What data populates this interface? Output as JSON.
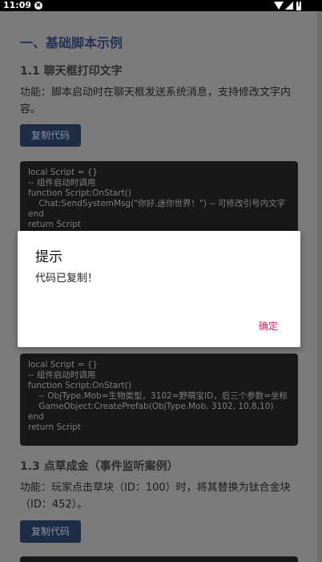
{
  "status_bar": {
    "time": "11:09",
    "notification_glyph": "✖"
  },
  "content": {
    "section_title": "一、基础脚本示例",
    "examples": [
      {
        "title": "1.1 聊天框打印文字",
        "desc": "功能：脚本启动时在聊天框发送系统消息，支持修改文字内容。",
        "copy_label": "复制代码",
        "code": "local Script = {}\n-- 组件启动时调用\nfunction Script:OnStart()\n    Chat:SendSystemMsg(\"你好,迷你世界！\") -- 可修改引号内文字\nend\nreturn Script"
      },
      {
        "title": "",
        "desc": "",
        "copy_label": "",
        "code": "local Script = {}\n-- 组件启动时调用\nfunction Script:OnStart()\n    -- ObjType.Mob=生物类型，3102=野萌宝ID，后三个参数=坐标\n    GameObject:CreatePrefab(ObjType.Mob, 3102, 10,8,10)\nend\nreturn Script"
      },
      {
        "title": "1.3 点草成金（事件监听案例）",
        "desc": "功能：玩家点击草块（ID：100）时，将其替换为钛合金块（ID：452）。",
        "copy_label": "复制代码",
        "code": ""
      }
    ]
  },
  "dialog": {
    "title": "提示",
    "message": "代码已复制！",
    "ok_label": "确定"
  },
  "colors": {
    "accent": "#d81b60",
    "button_bg": "#1f2c45",
    "heading": "#243356"
  }
}
